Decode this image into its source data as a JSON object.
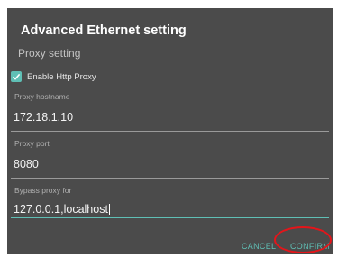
{
  "dialog": {
    "title": "Advanced Ethernet setting",
    "section_header": "Proxy setting",
    "enable_proxy": {
      "label": "Enable Http Proxy",
      "checked": true
    },
    "fields": {
      "hostname": {
        "label": "Proxy hostname",
        "value": "172.18.1.10"
      },
      "port": {
        "label": "Proxy port",
        "value": "8080"
      },
      "bypass": {
        "label": "Bypass proxy for",
        "value": "127.0.0.1,localhost"
      }
    },
    "buttons": {
      "cancel": "CANCEL",
      "confirm": "CONFIRM"
    }
  },
  "colors": {
    "dialog_background": "#4b4b4b",
    "accent": "#5fbfb5",
    "highlight_ring": "#e4151a"
  }
}
